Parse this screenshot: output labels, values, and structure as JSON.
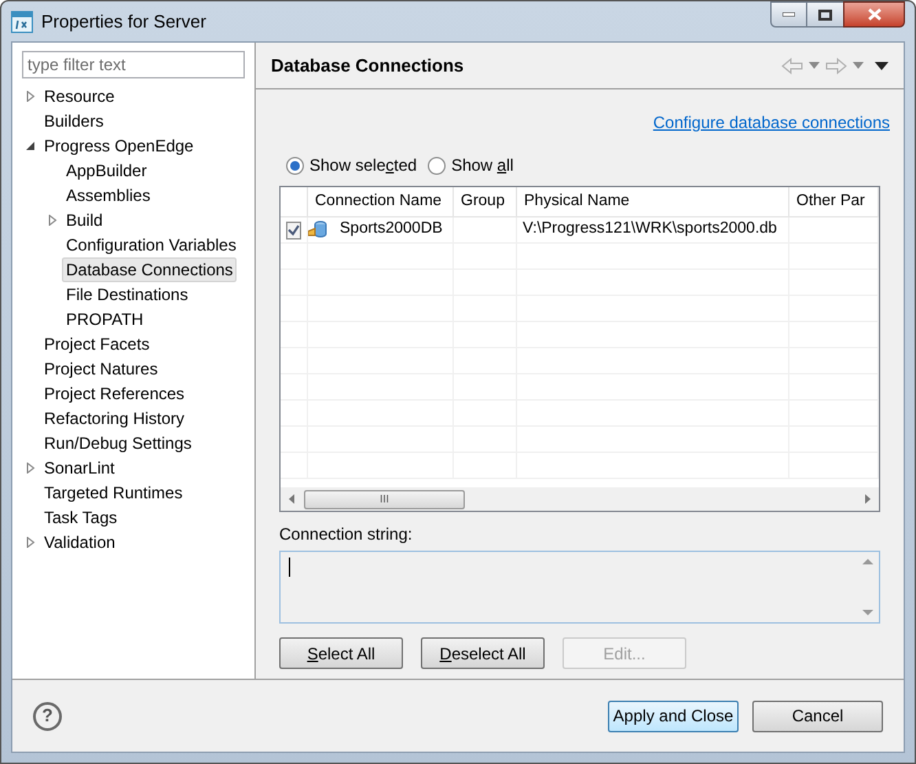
{
  "window": {
    "title": "Properties for Server"
  },
  "filter": {
    "placeholder": "type filter text"
  },
  "tree": [
    {
      "label": "Resource",
      "expanded": false,
      "selected": false
    },
    {
      "label": "Builders",
      "selected": false
    },
    {
      "label": "Progress OpenEdge",
      "expanded": true,
      "selected": false,
      "children": [
        {
          "label": "AppBuilder",
          "selected": false
        },
        {
          "label": "Assemblies",
          "selected": false
        },
        {
          "label": "Build",
          "expanded": false,
          "selected": false
        },
        {
          "label": "Configuration Variables",
          "selected": false
        },
        {
          "label": "Database Connections",
          "selected": true
        },
        {
          "label": "File Destinations",
          "selected": false
        },
        {
          "label": "PROPATH",
          "selected": false
        }
      ]
    },
    {
      "label": "Project Facets",
      "selected": false
    },
    {
      "label": "Project Natures",
      "selected": false
    },
    {
      "label": "Project References",
      "selected": false
    },
    {
      "label": "Refactoring History",
      "selected": false
    },
    {
      "label": "Run/Debug Settings",
      "selected": false
    },
    {
      "label": "SonarLint",
      "expanded": false,
      "selected": false
    },
    {
      "label": "Targeted Runtimes",
      "selected": false
    },
    {
      "label": "Task Tags",
      "selected": false
    },
    {
      "label": "Validation",
      "expanded": false,
      "selected": false
    }
  ],
  "page": {
    "title": "Database Connections",
    "link": "Configure database connections",
    "radios": [
      {
        "label": [
          {
            "text": "Show sele"
          },
          {
            "text": "c",
            "underline": true
          },
          {
            "text": "ted"
          }
        ],
        "selected": true
      },
      {
        "label": [
          {
            "text": "Show "
          },
          {
            "text": "a",
            "underline": true
          },
          {
            "text": "ll"
          }
        ],
        "selected": false
      }
    ],
    "table": {
      "columns": [
        "Connection Name",
        "Group",
        "Physical Name",
        "Other Par"
      ],
      "rows": [
        {
          "checked": true,
          "cells": [
            "Sports2000DB",
            null,
            "V:\\Progress121\\WRK\\sports2000.db",
            null
          ]
        }
      ]
    },
    "scroll_thumb_glyph": "III",
    "connection_label": "Connection string:",
    "buttons": [
      {
        "label": [
          {
            "text": "S",
            "underline": true
          },
          {
            "text": "elect All"
          }
        ],
        "disabled": false
      },
      {
        "label": [
          {
            "text": "D",
            "underline": true
          },
          {
            "text": "eselect All"
          }
        ],
        "disabled": false
      },
      {
        "label": [
          {
            "text": "Edit..."
          }
        ],
        "disabled": true
      }
    ]
  },
  "footer": {
    "help": "?",
    "buttons": [
      {
        "label": "Apply and Close",
        "default": true
      },
      {
        "label": "Cancel",
        "default": false
      }
    ]
  }
}
